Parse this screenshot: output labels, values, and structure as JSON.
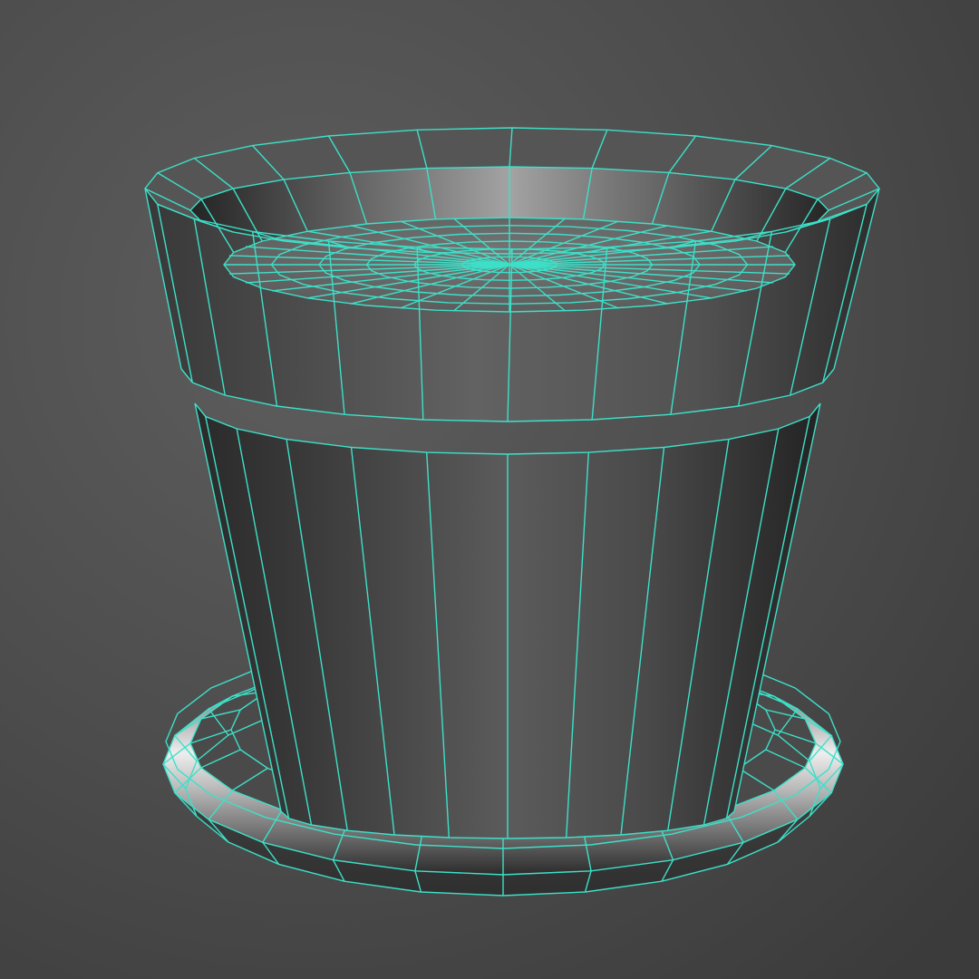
{
  "viewport": {
    "background": "#474747",
    "wireframe_color": "#3de0c8"
  },
  "model": {
    "object": "flower-pot-with-saucer",
    "shading": "smooth-shaded-with-wireframe-on-shaded",
    "radial_segments": 24
  }
}
